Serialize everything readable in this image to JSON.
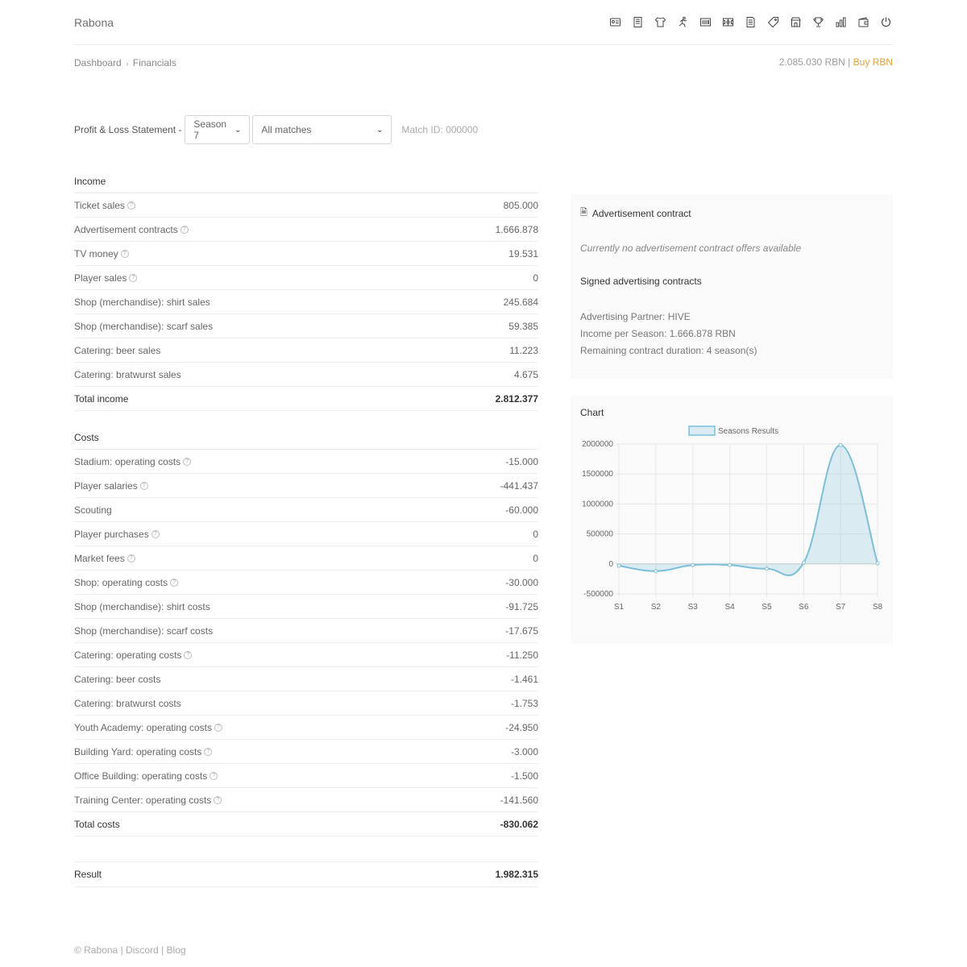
{
  "brand": "Rabona",
  "nav_icons": [
    "id-card-icon",
    "building-icon",
    "shirt-icon",
    "running-icon",
    "barcode-icon",
    "pitch-icon",
    "document-icon",
    "tag-icon",
    "store-icon",
    "trophy-icon",
    "bar-chart-icon",
    "wallet-icon",
    "power-icon"
  ],
  "breadcrumb": {
    "root": "Dashboard",
    "separator": "›",
    "current": "Financials"
  },
  "balance": {
    "amount": "2.085.030 RBN",
    "divider": "|",
    "buy_label": "Buy RBN"
  },
  "filters": {
    "label": "Profit & Loss Statement -",
    "season": "Season 7",
    "matches": "All matches",
    "match_id": "Match ID: 000000"
  },
  "income": {
    "title": "Income",
    "rows": [
      {
        "label": "Ticket sales",
        "value": "805.000",
        "help": true
      },
      {
        "label": "Advertisement contracts",
        "value": "1.666.878",
        "help": true
      },
      {
        "label": "TV money",
        "value": "19.531",
        "help": true
      },
      {
        "label": "Player sales",
        "value": "0",
        "help": true
      },
      {
        "label": "Shop (merchandise): shirt sales",
        "value": "245.684",
        "help": false
      },
      {
        "label": "Shop (merchandise): scarf sales",
        "value": "59.385",
        "help": false
      },
      {
        "label": "Catering: beer sales",
        "value": "11.223",
        "help": false
      },
      {
        "label": "Catering: bratwurst sales",
        "value": "4.675",
        "help": false
      }
    ],
    "total_label": "Total income",
    "total_value": "2.812.377"
  },
  "costs": {
    "title": "Costs",
    "rows": [
      {
        "label": "Stadium: operating costs",
        "value": "-15.000",
        "help": true
      },
      {
        "label": "Player salaries",
        "value": "-441.437",
        "help": true
      },
      {
        "label": "Scouting",
        "value": "-60.000",
        "help": false
      },
      {
        "label": "Player purchases",
        "value": "0",
        "help": true
      },
      {
        "label": "Market fees",
        "value": "0",
        "help": true
      },
      {
        "label": "Shop: operating costs",
        "value": "-30.000",
        "help": true
      },
      {
        "label": "Shop (merchandise): shirt costs",
        "value": "-91.725",
        "help": false
      },
      {
        "label": "Shop (merchandise): scarf costs",
        "value": "-17.675",
        "help": false
      },
      {
        "label": "Catering: operating costs",
        "value": "-11.250",
        "help": true
      },
      {
        "label": "Catering: beer costs",
        "value": "-1.461",
        "help": false
      },
      {
        "label": "Catering: bratwurst costs",
        "value": "-1.753",
        "help": false
      },
      {
        "label": "Youth Academy: operating costs",
        "value": "-24.950",
        "help": true
      },
      {
        "label": "Building Yard: operating costs",
        "value": "-3.000",
        "help": true
      },
      {
        "label": "Office Building: operating costs",
        "value": "-1.500",
        "help": true
      },
      {
        "label": "Training Center: operating costs",
        "value": "-141.560",
        "help": true
      }
    ],
    "total_label": "Total costs",
    "total_value": "-830.062"
  },
  "result": {
    "label": "Result",
    "value": "1.982.315"
  },
  "ad_panel": {
    "title": "Advertisement contract",
    "no_offers": "Currently no advertisement contract offers available",
    "signed_title": "Signed advertising contracts",
    "partner": "Advertising Partner: HIVE",
    "income": "Income per Season: 1.666.878 RBN",
    "remaining": "Remaining contract duration: 4 season(s)"
  },
  "chart_panel": {
    "title": "Chart"
  },
  "chart_data": {
    "type": "area",
    "title": "",
    "x": [
      "S1",
      "S2",
      "S3",
      "S4",
      "S5",
      "S6",
      "S7",
      "S8"
    ],
    "series": [
      {
        "name": "Seasons Results",
        "values": [
          -30000,
          -120000,
          -20000,
          -20000,
          -80000,
          20000,
          1982315,
          10000
        ]
      }
    ],
    "ylim": [
      -500000,
      2000000
    ],
    "yticks": [
      -500000,
      0,
      500000,
      1000000,
      1500000,
      2000000
    ],
    "legend": "top",
    "grid": true,
    "color": "#7bbfd9"
  },
  "footer": {
    "copyright": "© Rabona",
    "discord": "Discord",
    "blog": "Blog",
    "sep": "|"
  }
}
